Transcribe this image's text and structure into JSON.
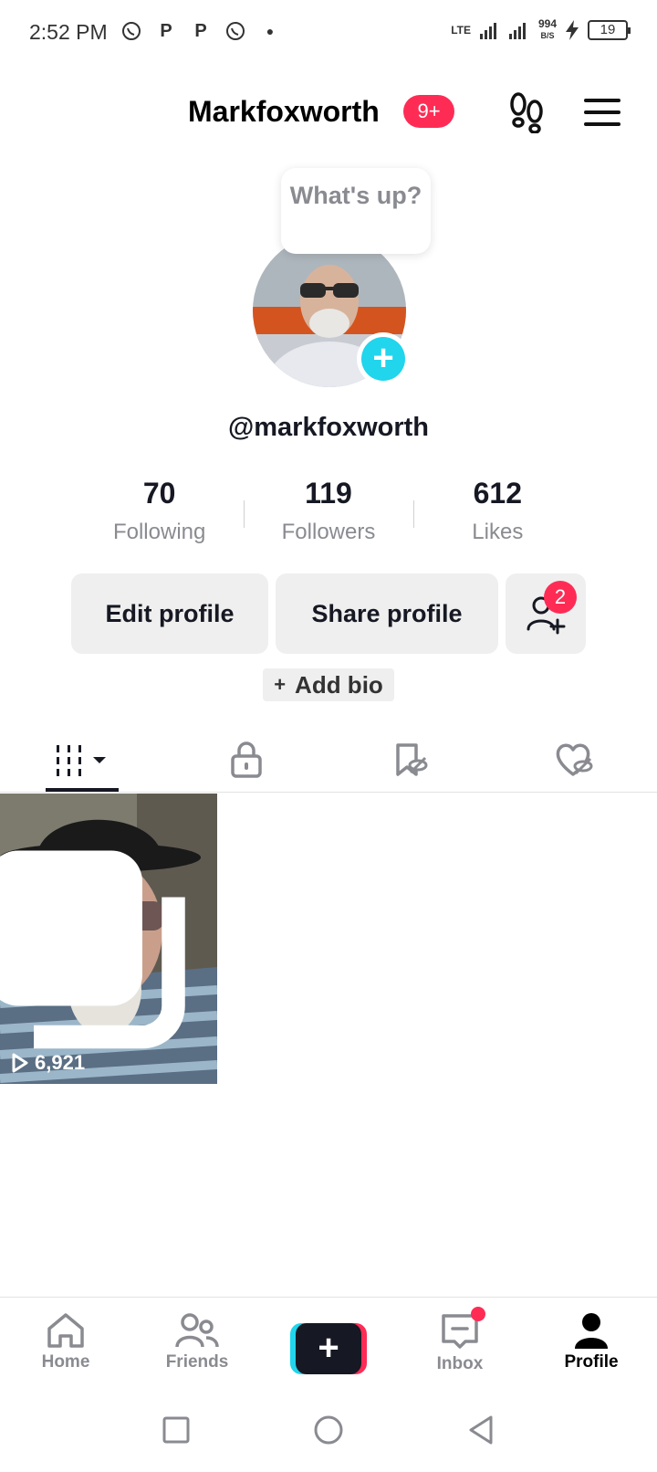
{
  "status_bar": {
    "time": "2:52 PM",
    "network": "LTE",
    "speed_value": "994",
    "speed_unit": "B/S",
    "battery": "19"
  },
  "header": {
    "title": "Markfoxworth",
    "notification_badge": "9+"
  },
  "profile": {
    "bubble_text": "What's up?",
    "handle": "@markfoxworth",
    "stats": [
      {
        "value": "70",
        "label": "Following"
      },
      {
        "value": "119",
        "label": "Followers"
      },
      {
        "value": "612",
        "label": "Likes"
      }
    ],
    "buttons": {
      "edit": "Edit profile",
      "share": "Share profile",
      "add_friends_badge": "2"
    },
    "add_bio": "Add bio",
    "add_bio_plus": "+"
  },
  "videos": [
    {
      "views": "6,921",
      "pinned": true
    }
  ],
  "bottom_nav": {
    "items": [
      {
        "label": "Home",
        "icon": "home-icon"
      },
      {
        "label": "Friends",
        "icon": "friends-icon"
      },
      {
        "label": "",
        "icon": "create-plus-icon"
      },
      {
        "label": "Inbox",
        "icon": "inbox-icon"
      },
      {
        "label": "Profile",
        "icon": "profile-icon"
      }
    ],
    "active": "Profile"
  },
  "colors": {
    "accent_red": "#fe2c55",
    "accent_cyan": "#20d5ec",
    "text_primary": "#161823",
    "text_secondary": "#8a8b91"
  }
}
